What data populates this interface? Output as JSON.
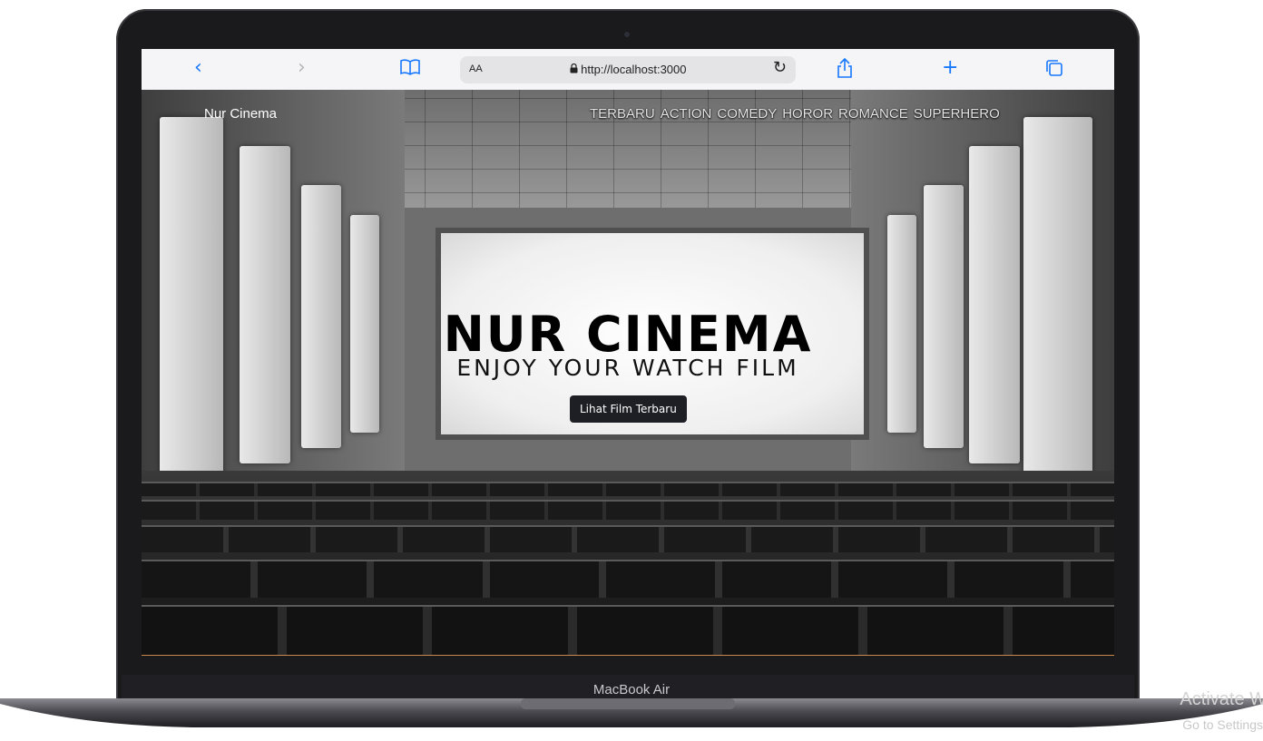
{
  "browser": {
    "text_size_label": "AA",
    "url": "http://localhost:3000",
    "icons": {
      "back": "chevron-left-icon",
      "forward": "chevron-right-icon",
      "bookmarks": "book-icon",
      "lock": "lock-icon",
      "reload": "reload-icon",
      "share": "share-icon",
      "new_tab": "plus-icon",
      "tabs": "tabs-icon"
    }
  },
  "site": {
    "brand": "Nur Cinema",
    "nav": [
      "TERBARU",
      "ACTION",
      "COMEDY",
      "HOROR",
      "ROMANCE",
      "SUPERHERO"
    ],
    "hero_title": "NUR CINEMA",
    "hero_subtitle": "ENJOY YOUR WATCH FILM",
    "cta_label": "Lihat Film Terbaru"
  },
  "device": {
    "model_label": "MacBook Air"
  },
  "overlay": {
    "watermark_title": "Activate W",
    "watermark_sub": "Go to Settings"
  },
  "colors": {
    "accent": "#1677ff",
    "button_bg": "#1e1f24"
  }
}
